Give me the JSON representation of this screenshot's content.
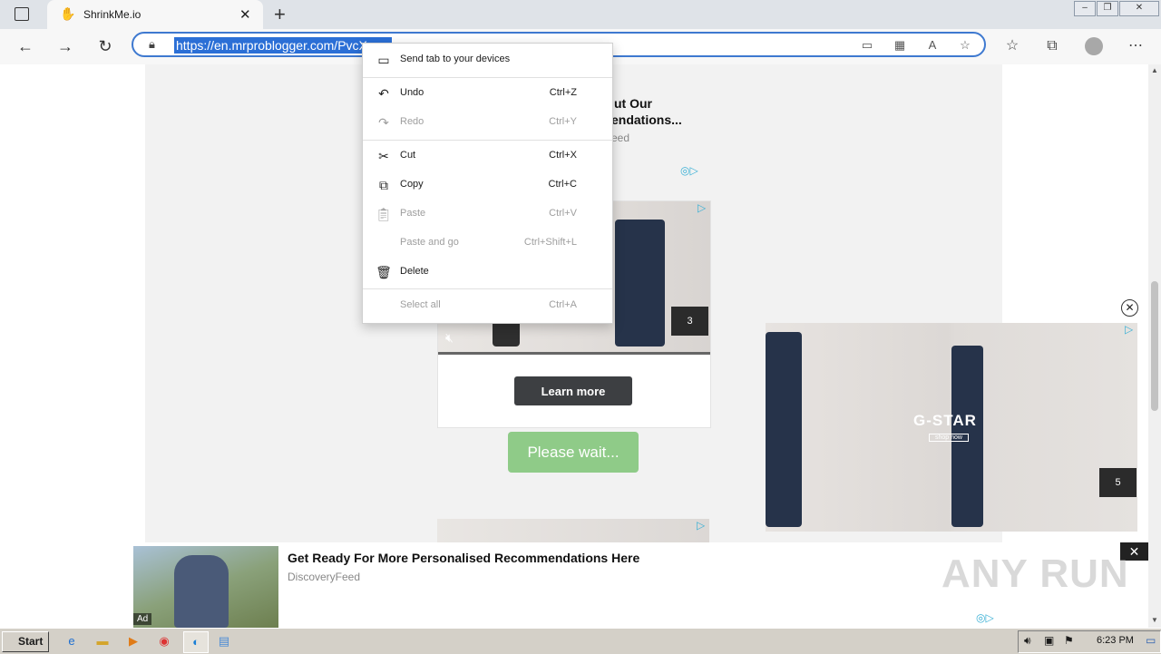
{
  "browser": {
    "tab_title": "ShrinkMe.io",
    "url": "https://en.mrproblogger.com/PvcX..."
  },
  "context_menu": {
    "items": [
      {
        "label": "Send tab to your devices",
        "shortcut": "",
        "enabled": true,
        "icon": "send-to-devices-icon"
      },
      {
        "label": "Undo",
        "shortcut": "Ctrl+Z",
        "enabled": true,
        "icon": "undo-icon"
      },
      {
        "label": "Redo",
        "shortcut": "Ctrl+Y",
        "enabled": false,
        "icon": "redo-icon"
      },
      {
        "label": "Cut",
        "shortcut": "Ctrl+X",
        "enabled": true,
        "icon": "scissors-icon"
      },
      {
        "label": "Copy",
        "shortcut": "Ctrl+C",
        "enabled": true,
        "icon": "copy-icon"
      },
      {
        "label": "Paste",
        "shortcut": "Ctrl+V",
        "enabled": false,
        "icon": "paste-icon"
      },
      {
        "label": "Paste and go",
        "shortcut": "Ctrl+Shift+L",
        "enabled": false,
        "icon": ""
      },
      {
        "label": "Delete",
        "shortcut": "",
        "enabled": true,
        "icon": "trash-icon"
      },
      {
        "label": "Select all",
        "shortcut": "Ctrl+A",
        "enabled": false,
        "icon": ""
      }
    ]
  },
  "page": {
    "ad1_title_line1": "ut Our",
    "ad1_title_line2": "endations...",
    "ad1_source": "eed",
    "video_ad_counter": "3",
    "learn_more": "Learn more",
    "please_wait": "Please wait...",
    "side_ad_brand": "G-STAR",
    "side_ad_cta": "shop now",
    "side_ad_counter": "5",
    "banner_title": "Get Ready For More Personalised Recommendations Here",
    "banner_source": "DiscoveryFeed",
    "banner_ad_label": "Ad",
    "watermark": "ANY RUN"
  },
  "taskbar": {
    "start_label": "Start",
    "clock": "6:23 PM"
  },
  "colors": {
    "accent": "#2b6fd6",
    "please_wait_bg": "#8fcb88",
    "learn_more_bg": "#3d3f42"
  }
}
